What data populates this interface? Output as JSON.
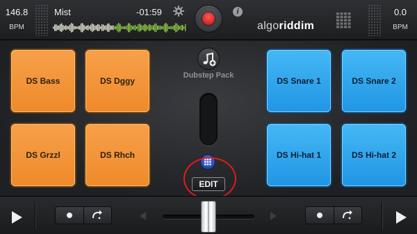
{
  "deck_left": {
    "bpm": "146.8",
    "bpm_label": "BPM",
    "title": "Mist",
    "time": "-01:59"
  },
  "deck_right": {
    "bpm": "0.0",
    "bpm_label": "BPM"
  },
  "brand": {
    "light": "algo",
    "bold": "riddim"
  },
  "pack": {
    "name": "Dubstep Pack"
  },
  "pads_left": [
    {
      "label": "DS Bass"
    },
    {
      "label": "DS Dggy"
    },
    {
      "label": "DS Grzzl"
    },
    {
      "label": "DS Rhch"
    }
  ],
  "pads_right": [
    {
      "label": "DS Snare 1"
    },
    {
      "label": "DS Snare 2"
    },
    {
      "label": "DS Hi-hat 1"
    },
    {
      "label": "DS Hi-hat 2"
    }
  ],
  "edit_button": {
    "label": "EDIT"
  },
  "icons": {
    "settings": "gear-icon",
    "record": "record-icon",
    "info": "info-icon",
    "pack": "music-note-plus-icon",
    "pad_grid": "grid-icon",
    "play": "play-icon",
    "loop_record": "record-dot-icon",
    "loop_redo": "redo-icon"
  },
  "colors": {
    "pad_orange": "#ee8a2a",
    "pad_blue": "#2095e4",
    "record_red": "#e01b1b",
    "highlight": "#e31b1b",
    "grid_button": "#2f52c0"
  }
}
